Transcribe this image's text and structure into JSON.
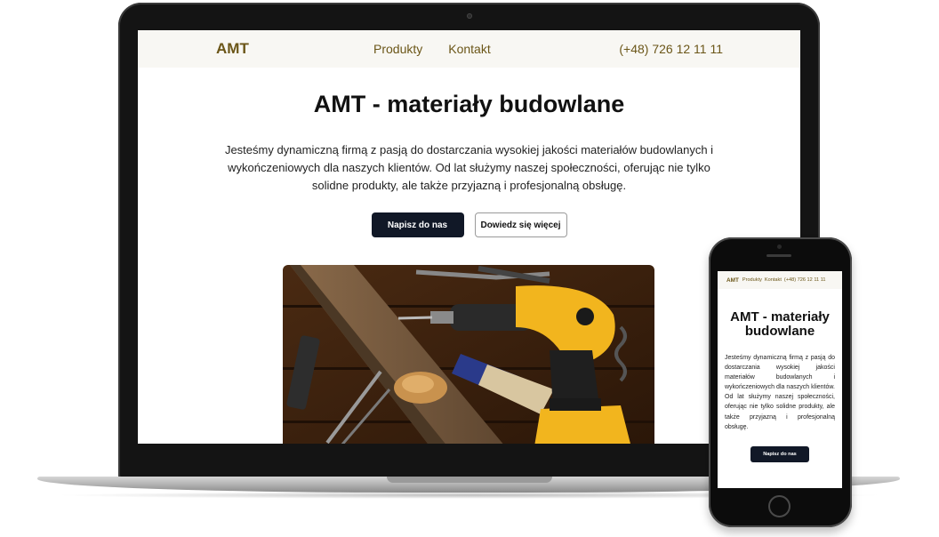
{
  "site": {
    "logo": "AMT",
    "nav": [
      "Produkty",
      "Kontakt"
    ],
    "phone": "(+48) 726 12 11 11",
    "title": "AMT - materiały budowlane",
    "title_mobile": "AMT - materiały budowlane",
    "description": "Jesteśmy dynamiczną firmą z pasją do dostarczania wysokiej jakości materiałów budowlanych i wykończeniowych dla naszych klientów. Od lat służymy naszej społeczności, oferując nie tylko solidne produkty, ale także przyjazną i profesjonalną obsługę.",
    "primary_button": "Napisz do nas",
    "secondary_button": "Dowiedz się więcej"
  },
  "hero_image": {
    "icon": "tools-drill-photo",
    "accent_color": "#f2b51e",
    "wood_color": "#6b3f1e"
  },
  "colors": {
    "brand": "#6b5618",
    "dark_button": "#111827",
    "nav_bg": "#f8f7f3"
  }
}
